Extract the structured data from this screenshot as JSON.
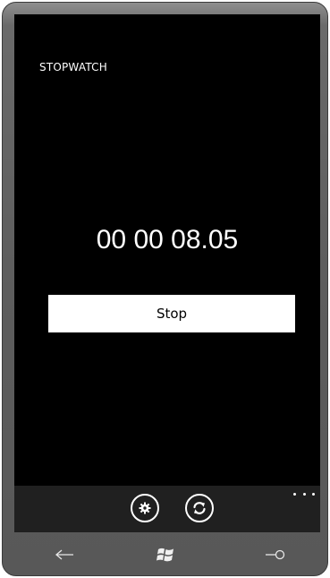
{
  "app": {
    "title": "STOPWATCH",
    "elapsed_time": "00 00 08.05"
  },
  "controls": {
    "stop_label": "Stop"
  },
  "app_bar": {
    "buttons": [
      {
        "icon": "settings-icon"
      },
      {
        "icon": "reset-icon"
      }
    ],
    "more_icon": "ellipsis-icon"
  },
  "hardware_buttons": [
    "back-arrow-icon",
    "windows-logo-icon",
    "search-icon"
  ]
}
